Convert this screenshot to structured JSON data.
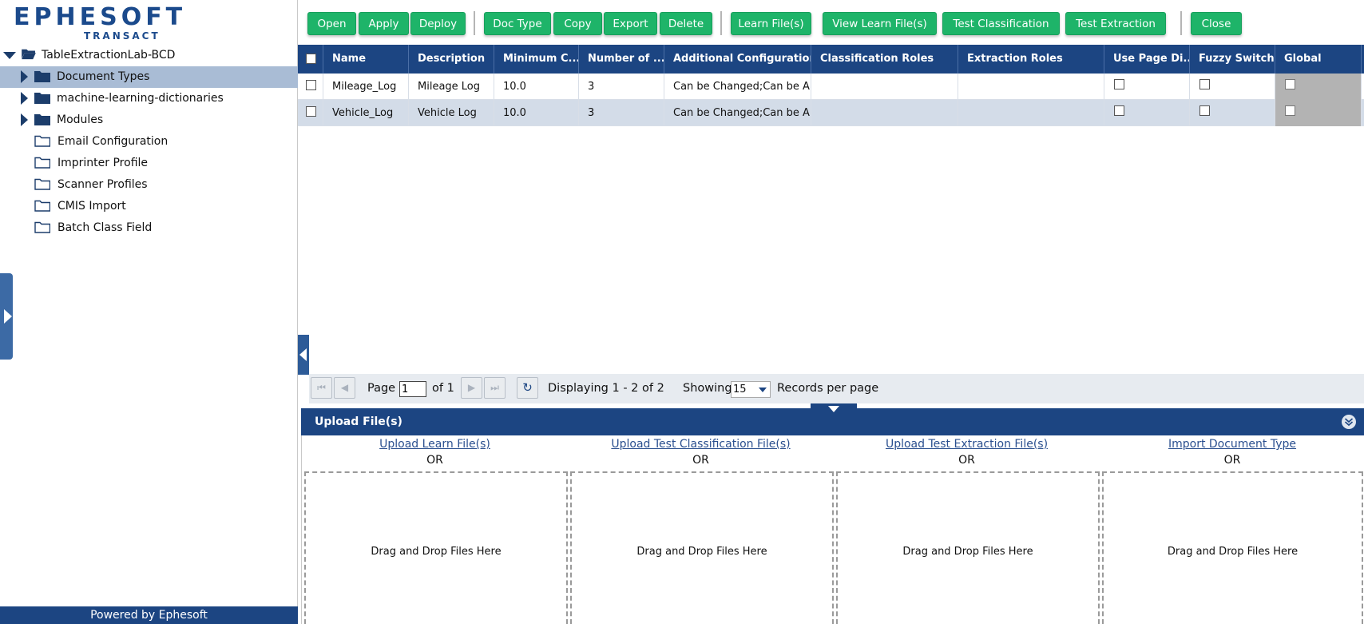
{
  "brand": {
    "logo_top": "EPHESOFT",
    "logo_bottom": "TRANSACT",
    "accent": "#1eb469",
    "primary": "#1c4582"
  },
  "tree": {
    "root": {
      "label": "TableExtractionLab-BCD",
      "icon": "folder-open-icon"
    },
    "items": [
      {
        "label": "Document Types",
        "icon": "folder-filled-icon",
        "expandable": true
      },
      {
        "label": "machine-learning-dictionaries",
        "icon": "folder-filled-icon",
        "expandable": true
      },
      {
        "label": "Modules",
        "icon": "folder-filled-icon",
        "expandable": true
      },
      {
        "label": "Email Configuration",
        "icon": "folder-outline-icon",
        "expandable": false
      },
      {
        "label": "Imprinter Profile",
        "icon": "folder-outline-icon",
        "expandable": false
      },
      {
        "label": "Scanner Profiles",
        "icon": "folder-outline-icon",
        "expandable": false
      },
      {
        "label": "CMIS Import",
        "icon": "folder-outline-icon",
        "expandable": false
      },
      {
        "label": "Batch Class Field",
        "icon": "folder-outline-icon",
        "expandable": false
      }
    ],
    "selected": "Document Types"
  },
  "footer": {
    "powered_by": "Powered by Ephesoft"
  },
  "toolbar": {
    "open": "Open",
    "apply": "Apply",
    "deploy": "Deploy",
    "doc_type": "Doc Type",
    "copy": "Copy",
    "export": "Export",
    "delete": "Delete",
    "learn_files": "Learn File(s)",
    "view_learn_files": "View Learn File(s)",
    "test_classification": "Test Classification",
    "test_extraction": "Test Extraction",
    "close": "Close"
  },
  "grid": {
    "headers": [
      "Name",
      "Description",
      "Minimum C...",
      "Number of ...",
      "Additional Configurations",
      "Classification Roles",
      "Extraction Roles",
      "Use Page Di...",
      "Fuzzy Switch",
      "Global"
    ],
    "rows": [
      {
        "name": "Mileage_Log",
        "description": "Mileage Log",
        "min_conf": "10.0",
        "num": "3",
        "additional": "Can be Changed;Can be A...",
        "class_roles": "",
        "extr_roles": "",
        "use_page": false,
        "fuzzy": false,
        "global": false
      },
      {
        "name": "Vehicle_Log",
        "description": "Vehicle Log",
        "min_conf": "10.0",
        "num": "3",
        "additional": "Can be Changed;Can be A...",
        "class_roles": "",
        "extr_roles": "",
        "use_page": false,
        "fuzzy": false,
        "global": false
      }
    ]
  },
  "pager": {
    "page_label": "Page",
    "page_value": "1",
    "of_label": "of 1",
    "displaying": "Displaying 1 - 2 of 2",
    "showing": "Showing",
    "per_page_value": "15",
    "records_label": "Records per page"
  },
  "upload": {
    "title": "Upload File(s)",
    "columns": [
      {
        "link": "Upload Learn File(s)",
        "or": "OR",
        "drop": "Drag and Drop Files Here"
      },
      {
        "link": "Upload Test Classification File(s)",
        "or": "OR",
        "drop": "Drag and Drop Files Here"
      },
      {
        "link": "Upload Test Extraction File(s)",
        "or": "OR",
        "drop": "Drag and Drop Files Here"
      },
      {
        "link": "Import Document Type",
        "or": "OR",
        "drop": "Drag and Drop Files Here"
      }
    ]
  }
}
